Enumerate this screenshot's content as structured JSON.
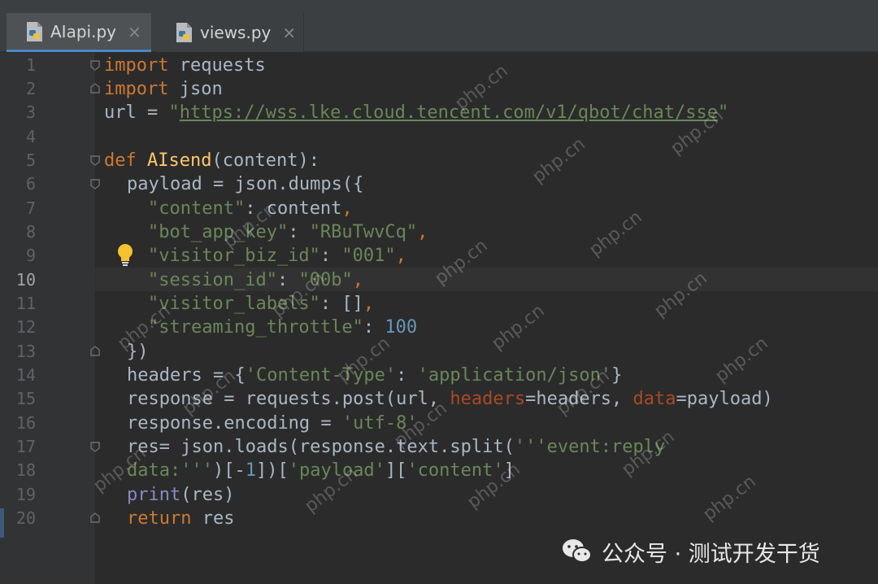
{
  "tabs": [
    {
      "label": "AIapi.py",
      "active": true,
      "close": "×"
    },
    {
      "label": "views.py",
      "active": false,
      "close": "×"
    }
  ],
  "line_numbers": [
    "1",
    "2",
    "3",
    "4",
    "5",
    "6",
    "7",
    "8",
    "9",
    "10",
    "11",
    "12",
    "13",
    "14",
    "15",
    "16",
    "17",
    "18",
    "19",
    "20"
  ],
  "current_line": "10",
  "code": {
    "l1": {
      "kw": "import",
      "rest": " requests"
    },
    "l2": {
      "kw": "import",
      "rest": " json"
    },
    "l3": {
      "a": "url = ",
      "q1": "\"",
      "url": "https://wss.lke.cloud.tencent.com/v1/qbot/chat/sse",
      "q2": "\""
    },
    "l5": {
      "kw": "def",
      "fn": "AIsend",
      "rest": "(content):"
    },
    "l6": {
      "a": "payload",
      "b": " = json.dumps({"
    },
    "l7": {
      "s": "\"content\"",
      "b": ": content",
      "c": ","
    },
    "l8": {
      "s": "\"bot_app_key\"",
      "b": ": ",
      "s2": "\"RBuTwvCq\"",
      "c": ","
    },
    "l9": {
      "s": "\"visitor_biz_id\"",
      "b": ": ",
      "s2": "\"001\"",
      "c": ","
    },
    "l10": {
      "s": "\"session_id\"",
      "b": ": ",
      "s2": "\"00b\"",
      "c": ","
    },
    "l11": {
      "s": "\"visitor_labels\"",
      "b": ": []",
      "c": ","
    },
    "l12": {
      "s": "\"streaming_throttle\"",
      "b": ": ",
      "n": "100"
    },
    "l13": {
      "a": "})"
    },
    "l14": {
      "a": "headers",
      "b": " = {",
      "s": "'Content-Type'",
      "c": ": ",
      "s2": "'application/json'",
      "d": "}"
    },
    "l15": {
      "a": "response",
      "b": " = requests.post(url, ",
      "p1": "headers",
      "c": "=headers, ",
      "p2": "data",
      "d": "=payload)"
    },
    "l16": {
      "a": "response",
      "b": ".encoding = ",
      "s": "'utf-8'"
    },
    "l17": {
      "a": "res",
      "b": "= json.loads(response.text.split(",
      "s": "'''event:reply"
    },
    "l18": {
      "s": "data:'''",
      "b": ")[-",
      "n": "1",
      "c": "])[",
      "s2": "'payload'",
      "d": "][",
      "s3": "'content'",
      "e": "]"
    },
    "l19": {
      "fn": "print",
      "b": "(res)"
    },
    "l20": {
      "kw": "return",
      "b": " ",
      "v": "res"
    }
  },
  "watermark_text": "php.cn",
  "brand_text": "公众号 · 测试开发干货",
  "colors": {
    "bg": "#2b2b2b",
    "keyword": "#cc7832",
    "function": "#ffc66d",
    "string": "#6a8759",
    "number": "#6897bb"
  }
}
